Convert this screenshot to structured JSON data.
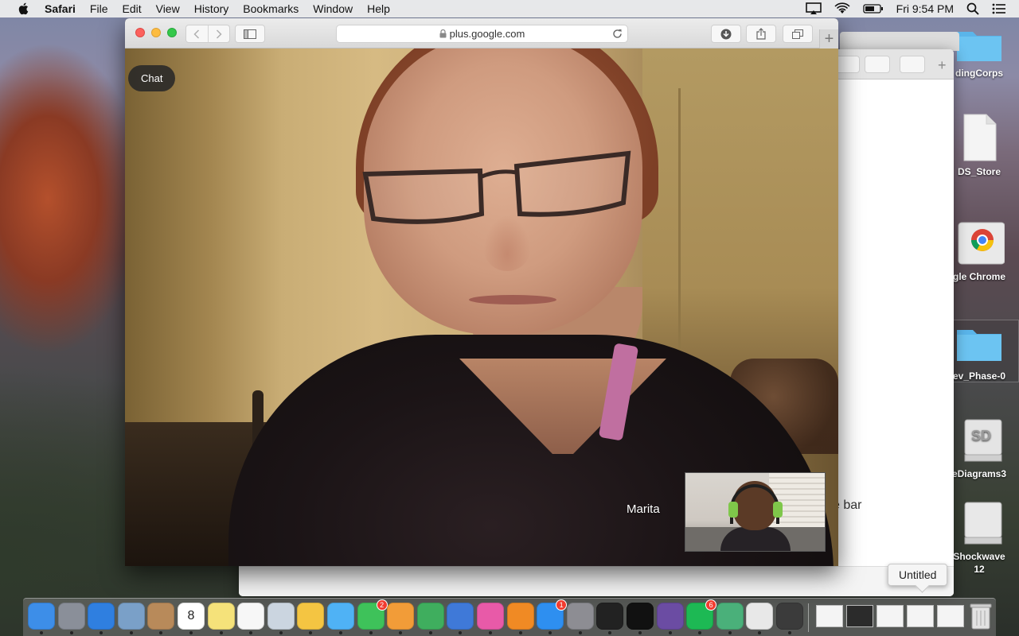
{
  "menubar": {
    "app_name": "Safari",
    "items": [
      "File",
      "Edit",
      "View",
      "History",
      "Bookmarks",
      "Window",
      "Help"
    ],
    "clock": "Fri 9:54 PM",
    "status_icons": [
      "airplay-icon",
      "wifi-icon",
      "battery-icon",
      "spotlight-icon",
      "notification-center-icon"
    ]
  },
  "desktop_icons": [
    {
      "label": "dingCorps",
      "icon": "folder-icon"
    },
    {
      "label": "DS_Store",
      "icon": "document-icon"
    },
    {
      "label": "gle Chrome",
      "icon": "chrome-icon"
    },
    {
      "label": "ev_Phase-0",
      "icon": "folder-icon"
    },
    {
      "label": "eDiagrams3",
      "icon": "disk-image-icon"
    },
    {
      "label": "Shockwave",
      "label2": "12",
      "icon": "disk-image-icon"
    }
  ],
  "browser": {
    "url": "plus.google.com"
  },
  "call": {
    "chat_label": "Chat",
    "participant_name": "Marita"
  },
  "back_window": {
    "peek_text": "e bar"
  },
  "dock": {
    "tooltip": "Untitled",
    "apps": [
      {
        "name": "finder-icon",
        "color": "#3d8ee8"
      },
      {
        "name": "launchpad-icon",
        "color": "#8a8f99"
      },
      {
        "name": "safari-icon",
        "color": "#2f7fe0"
      },
      {
        "name": "preview-icon",
        "color": "#7aa0c8"
      },
      {
        "name": "contacts-icon",
        "color": "#b88a5a"
      },
      {
        "name": "calendar-icon",
        "color": "#ffffff",
        "text": "8"
      },
      {
        "name": "notes-icon",
        "color": "#f5e27a"
      },
      {
        "name": "reminders-icon",
        "color": "#f7f7f7"
      },
      {
        "name": "photo-booth-icon",
        "color": "#cbd5e0"
      },
      {
        "name": "photos-icon",
        "color": "#f4c542"
      },
      {
        "name": "messages-icon",
        "color": "#4fb2f5"
      },
      {
        "name": "facetime-icon",
        "color": "#3ec25a",
        "badge": "2"
      },
      {
        "name": "pages-icon",
        "color": "#f29c38"
      },
      {
        "name": "numbers-icon",
        "color": "#3fae5e"
      },
      {
        "name": "keynote-icon",
        "color": "#3f79d8"
      },
      {
        "name": "itunes-icon",
        "color": "#e85aa8"
      },
      {
        "name": "ibooks-icon",
        "color": "#f08a24"
      },
      {
        "name": "app-store-icon",
        "color": "#2e8ff0",
        "badge": "1"
      },
      {
        "name": "system-preferences-icon",
        "color": "#8d8d93"
      },
      {
        "name": "terminal-icon",
        "color": "#222222"
      },
      {
        "name": "terminal-2-icon",
        "color": "#111111"
      },
      {
        "name": "github-icon",
        "color": "#6b4ca3"
      },
      {
        "name": "spotify-icon",
        "color": "#1db954",
        "badge": "6"
      },
      {
        "name": "atom-icon",
        "color": "#4ab07a"
      },
      {
        "name": "chrome-icon",
        "color": "#e8e8e8"
      },
      {
        "name": "sublime-icon",
        "color": "#3b3b3b"
      }
    ]
  }
}
